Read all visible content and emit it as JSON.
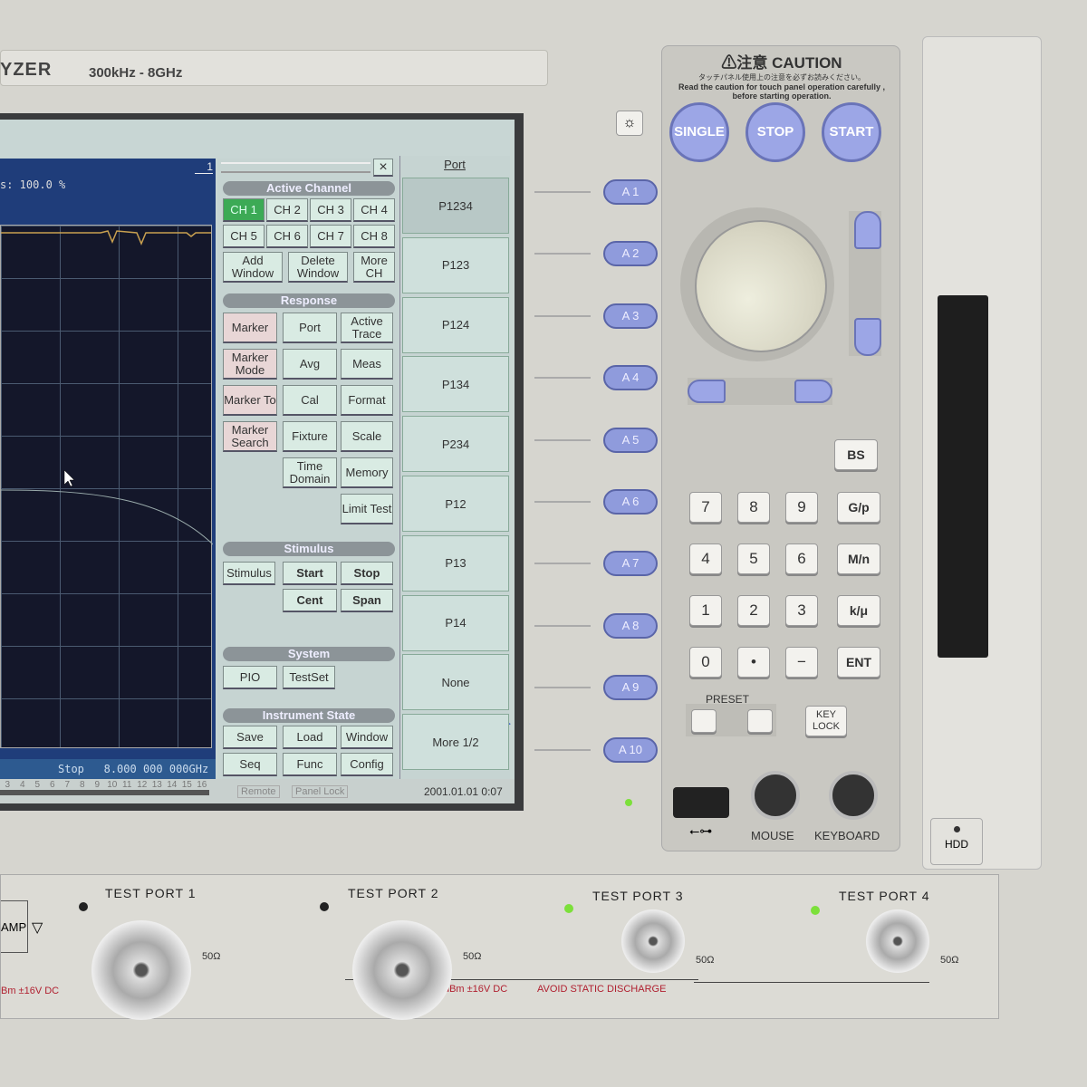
{
  "header": {
    "brand": "YZER",
    "range": "300kHz - 8GHz"
  },
  "chart": {
    "status": "s: 100.0 %",
    "window_index": "1",
    "stop_label": "Stop",
    "stop_value": "8.000 000 000GHz",
    "channel_numbers": [
      "3",
      "4",
      "5",
      "6",
      "7",
      "8",
      "9",
      "10",
      "11",
      "12",
      "13",
      "14",
      "15",
      "16"
    ]
  },
  "statusbar": {
    "remote": "Remote",
    "panel_lock": "Panel Lock",
    "datetime": "2001.01.01 0:07"
  },
  "menu": {
    "close": "×",
    "sections": {
      "active_channel": "Active Channel",
      "response": "Response",
      "stimulus": "Stimulus",
      "system": "System",
      "instrument_state": "Instrument State"
    },
    "channels": [
      "CH 1",
      "CH 2",
      "CH 3",
      "CH 4",
      "CH 5",
      "CH 6",
      "CH 7",
      "CH 8"
    ],
    "window": [
      "Add Window",
      "Delete Window",
      "More CH"
    ],
    "response": [
      "Marker",
      "Port",
      "Active Trace",
      "Marker Mode",
      "Avg",
      "Meas",
      "Marker To",
      "Cal",
      "Format",
      "Marker Search",
      "Fixture",
      "Scale",
      "Time Domain",
      "Memory",
      "Limit Test"
    ],
    "stimulus": [
      "Stimulus",
      "Start",
      "Stop",
      "Cent",
      "Span"
    ],
    "system": [
      "PIO",
      "TestSet"
    ],
    "state": [
      "Save",
      "Load",
      "Window",
      "Seq",
      "Func",
      "Config"
    ]
  },
  "port_panel": {
    "title": "Port",
    "items": [
      "P1234",
      "P123",
      "P124",
      "P134",
      "P234",
      "P12",
      "P13",
      "P14",
      "None",
      "More 1/2"
    ]
  },
  "softkeys": [
    "A 1",
    "A 2",
    "A 3",
    "A 4",
    "A 5",
    "A 6",
    "A 7",
    "A 8",
    "A 9",
    "A 10"
  ],
  "front": {
    "caution_title": "⚠注意 CAUTION",
    "caution_jp": "タッチパネル使用上の注意を必ずお読みください。",
    "caution_en": "Read the caution for touch panel operation carefully , before starting operation.",
    "single": "SINGLE",
    "stop": "STOP",
    "start": "START",
    "bs": "BS",
    "keys": [
      "7",
      "8",
      "9",
      "G/p",
      "4",
      "5",
      "6",
      "M/n",
      "1",
      "2",
      "3",
      "k/μ",
      "0",
      "•",
      "−",
      "ENT"
    ],
    "preset": "PRESET",
    "key_lock": "KEY LOCK",
    "mouse": "MOUSE",
    "keyboard": "KEYBOARD",
    "hdd": "HDD"
  },
  "ports": {
    "labels": [
      "TEST PORT 1",
      "TEST PORT 2",
      "TEST PORT 3",
      "TEST PORT 4"
    ],
    "impedance": "50Ω",
    "amp": "AMP",
    "warn_left": "Bm ±16V DC",
    "warn_mid": "-21 dBm ±16V DC",
    "avoid": "AVOID STATIC DISCHARGE"
  },
  "colors": {
    "active_channel": "#3caa55",
    "softkey": "#8f9bdc",
    "led_on": "#7ce03a"
  }
}
